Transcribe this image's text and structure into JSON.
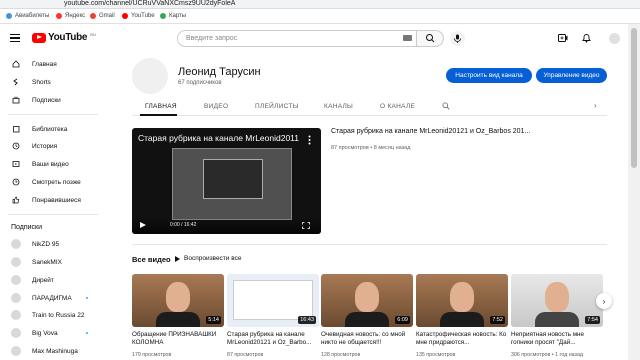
{
  "browser": {
    "url": "youtube.com/channel/UCRuVVaNXCmsz9UU2dyFoleA",
    "bookmarks": [
      "Авиабилеты",
      "Яндекс",
      "Gmail",
      "YouTube",
      "Карты"
    ]
  },
  "header": {
    "logo_text": "YouTube",
    "logo_region": "RU",
    "search_placeholder": "Введите запрос"
  },
  "sidebar": {
    "nav": [
      "Главная",
      "Shorts",
      "Подписки"
    ],
    "library": [
      "Библиотека",
      "История",
      "Ваши видео",
      "Смотреть позже",
      "Понравившиеся"
    ],
    "subscriptions_title": "Подписки",
    "subscriptions": [
      "NikZD 95",
      "SanekMIX",
      "Дирейт",
      "ПАРАДИГМА",
      "Train to Russia 22",
      "Big Vova",
      "Max Mashinuga"
    ]
  },
  "channel": {
    "name": "Леонид Тарусин",
    "subscribers": "67 подписчиков",
    "customize_btn": "Настроить вид канала",
    "manage_btn": "Управление видео",
    "tabs": [
      "ГЛАВНАЯ",
      "ВИДЕО",
      "ПЛЕЙЛИСТЫ",
      "КАНАЛЫ",
      "О КАНАЛЕ"
    ]
  },
  "featured": {
    "player_title": "Старая рубрика на канале MrLeonid2011",
    "time": "0:00 / 16:42",
    "title": "Старая рубрика на канале MrLeonid20121 и Oz_Barbos 201...",
    "meta": "87 просмотров • 8 месяц назад"
  },
  "section": {
    "title": "Все видео",
    "play_all": "Воспроизвести все"
  },
  "videos": [
    {
      "title": "Обращение ПРИЗНАВАШКИ КОЛОМНА",
      "duration": "5:14",
      "meta": "179 просмотров"
    },
    {
      "title": "Старая рубрика на канале MrLeonid20121 и Oz_Barbo...",
      "duration": "16:43",
      "meta": "87 просмотров"
    },
    {
      "title": "Очевидная новость: со мной никто не общается!!!",
      "duration": "6:09",
      "meta": "128 просмотров"
    },
    {
      "title": "Катастрофическая новость: Ко мне придраются...",
      "duration": "7:52",
      "meta": "135 просмотров"
    },
    {
      "title": "Неприятная новость мне гопники просят \"Дай...",
      "duration": "7:54",
      "meta": "306 просмотров • 1 год назад"
    }
  ],
  "colors": {
    "accent": "#065fd4",
    "logo_red": "#ff0000"
  }
}
